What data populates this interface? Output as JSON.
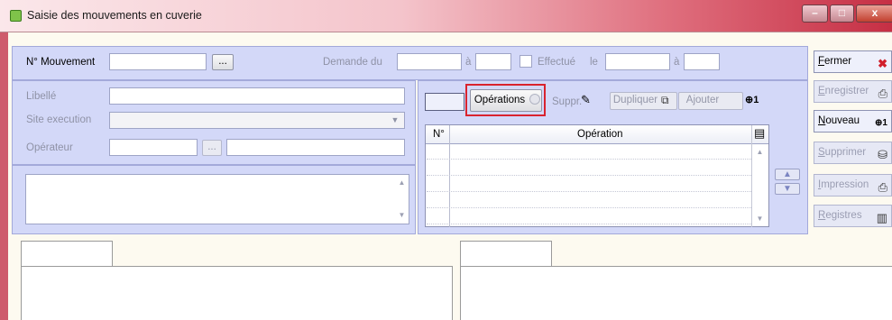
{
  "window": {
    "title": "Saisie des mouvements en cuverie",
    "minimize": "–",
    "maximize": "□",
    "close": "x"
  },
  "top": {
    "mouvement_label": "N° Mouvement",
    "mouvement_value": "",
    "browse_label": "...",
    "demande_label": "Demande du",
    "a1_label": "à",
    "effectue_label": "Effectué",
    "le_label": "le",
    "a2_label": "à"
  },
  "details": {
    "libelle_label": "Libellé",
    "site_label": "Site execution",
    "operateur_label": "Opérateur",
    "browse_label": "..."
  },
  "operations": {
    "tabs": [
      {
        "label": "Opérations"
      },
      {
        "label": "Suppr."
      },
      {
        "label": "Dupliquer"
      },
      {
        "label": "Ajouter"
      }
    ],
    "columns": [
      "N°",
      "Opération"
    ]
  },
  "side_buttons": [
    {
      "label": "Fermer",
      "underline": "F",
      "rest": "ermer",
      "icon": "exit-icon",
      "enabled": true
    },
    {
      "label": "Enregistrer",
      "underline": "E",
      "rest": "nregistrer",
      "icon": "save-icon",
      "enabled": false
    },
    {
      "label": "Nouveau",
      "underline": "N",
      "rest": "ouveau",
      "icon": "new-icon",
      "enabled": true
    },
    {
      "label": "Supprimer",
      "underline": "S",
      "rest": "upprimer",
      "icon": "delete-icon",
      "enabled": false
    },
    {
      "label": "Impression",
      "underline": "I",
      "rest": "mpression",
      "icon": "print-icon",
      "enabled": false
    },
    {
      "label": "Registres",
      "underline": "R",
      "rest": "egistres",
      "icon": "registers-icon",
      "enabled": false
    }
  ],
  "colors": {
    "panel": "#d3d8f8",
    "highlight": "#d9232e",
    "titlebar_end": "#c62f44"
  }
}
